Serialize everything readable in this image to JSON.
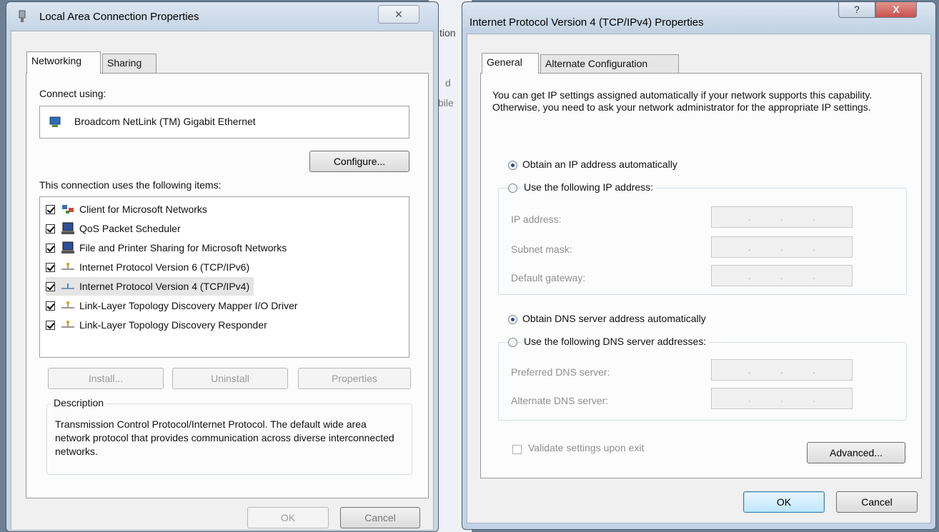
{
  "left_window": {
    "title": "Local Area Connection Properties",
    "close_glyph": "✕",
    "tabs": [
      "Networking",
      "Sharing"
    ],
    "connect_using_label": "Connect using:",
    "adapter_name": "Broadcom NetLink (TM) Gigabit Ethernet",
    "configure_label": "Configure...",
    "items_label": "This connection uses the following items:",
    "items": [
      {
        "label": "Client for Microsoft Networks",
        "checked": true,
        "icon": "network-client-icon"
      },
      {
        "label": "QoS Packet Scheduler",
        "checked": true,
        "icon": "service-icon"
      },
      {
        "label": "File and Printer Sharing for Microsoft Networks",
        "checked": true,
        "icon": "service-icon"
      },
      {
        "label": "Internet Protocol Version 6 (TCP/IPv6)",
        "checked": true,
        "icon": "protocol-icon"
      },
      {
        "label": "Internet Protocol Version 4 (TCP/IPv4)",
        "checked": true,
        "icon": "protocol-icon"
      },
      {
        "label": "Link-Layer Topology Discovery Mapper I/O Driver",
        "checked": true,
        "icon": "protocol-icon"
      },
      {
        "label": "Link-Layer Topology Discovery Responder",
        "checked": true,
        "icon": "protocol-icon"
      }
    ],
    "install_label": "Install...",
    "uninstall_label": "Uninstall",
    "properties_label": "Properties",
    "description_title": "Description",
    "description_text": "Transmission Control Protocol/Internet Protocol. The default wide area network protocol that provides communication across diverse interconnected networks.",
    "ok_label": "OK",
    "cancel_label": "Cancel"
  },
  "background_fragments": {
    "frag1": "tion",
    "frag2": "d",
    "frag3": "bile"
  },
  "right_window": {
    "title": "Internet Protocol Version 4 (TCP/IPv4) Properties",
    "help_glyph": "?",
    "close_glyph": "X",
    "tabs": [
      "General",
      "Alternate Configuration"
    ],
    "intro_text": "You can get IP settings assigned automatically if your network supports this capability. Otherwise, you need to ask your network administrator for the appropriate IP settings.",
    "ip_auto_label": "Obtain an IP address automatically",
    "ip_manual_label": "Use the following IP address:",
    "ip_address_label": "IP address:",
    "subnet_label": "Subnet mask:",
    "gateway_label": "Default gateway:",
    "dns_auto_label": "Obtain DNS server address automatically",
    "dns_manual_label": "Use the following DNS server addresses:",
    "preferred_dns_label": "Preferred DNS server:",
    "alternate_dns_label": "Alternate DNS server:",
    "ip_dot": ".",
    "validate_label": "Validate settings upon exit",
    "advanced_label": "Advanced...",
    "ok_label": "OK",
    "cancel_label": "Cancel"
  },
  "colors": {
    "close_red": "#c75050",
    "selection_bg": "#e5e5e5",
    "desktop": "#6c7f93"
  }
}
